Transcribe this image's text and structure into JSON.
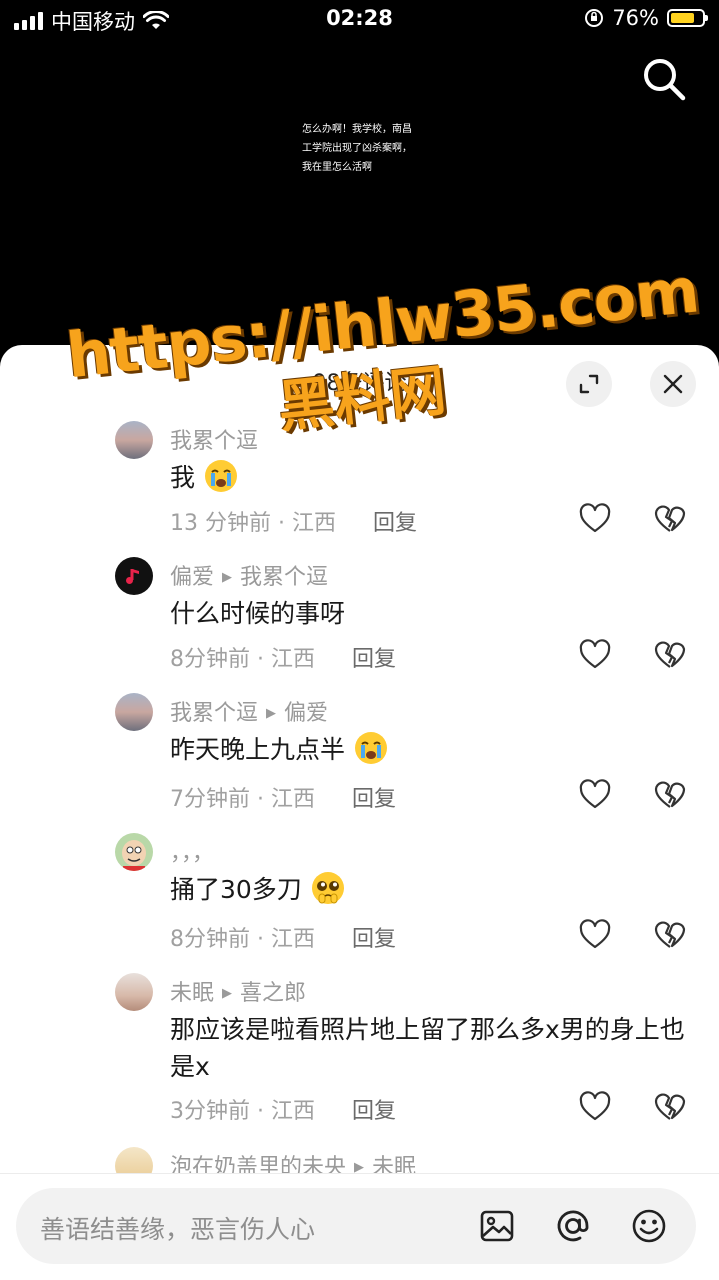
{
  "status_bar": {
    "carrier": "中国移动",
    "time": "02:28",
    "battery_percent": "76%",
    "battery_level": 0.76,
    "battery_color": "#ffd21f"
  },
  "video": {
    "caption": "怎么办啊！我学校，南昌工学院出现了凶杀案啊，我在里怎么活啊",
    "search_icon": "search-icon"
  },
  "sheet": {
    "comment_count": "98条评论",
    "expand_icon": "expand-icon",
    "close_icon": "close-icon"
  },
  "watermark": {
    "line1": "https://ihlw35.com",
    "line2": "黑料网"
  },
  "comments": [
    {
      "user": "我累个逗",
      "reply_to": "",
      "text": "我",
      "emoji": "crying-emoji",
      "time_location": "13 分钟前 · 江西",
      "reply_label": "回复"
    },
    {
      "user": "偏爱",
      "reply_to": "我累个逗",
      "text": "什么时候的事呀",
      "emoji": "",
      "time_location": "8分钟前 · 江西",
      "reply_label": "回复"
    },
    {
      "user": "我累个逗",
      "reply_to": "偏爱",
      "text": "昨天晚上九点半",
      "emoji": "crying-emoji",
      "time_location": "7分钟前 · 江西",
      "reply_label": "回复"
    },
    {
      "user": "，，，",
      "reply_to": "",
      "text": "捅了30多刀",
      "emoji": "pleading-emoji",
      "time_location": "8分钟前 · 江西",
      "reply_label": "回复"
    },
    {
      "user": "未眠",
      "reply_to": "喜之郎",
      "text": "那应该是啦看照片地上留了那么多x男的身上也是x",
      "emoji": "",
      "time_location": "3分钟前 · 江西",
      "reply_label": "回复"
    },
    {
      "user": "泡在奶盖里的未央",
      "reply_to": "未眠",
      "text": "",
      "emoji": "",
      "time_location": "",
      "reply_label": ""
    }
  ],
  "input": {
    "placeholder": "善语结善缘，恶言伤人心",
    "image_icon": "image-icon",
    "mention_icon": "at-mention-icon",
    "emoji_icon": "emoji-icon"
  }
}
